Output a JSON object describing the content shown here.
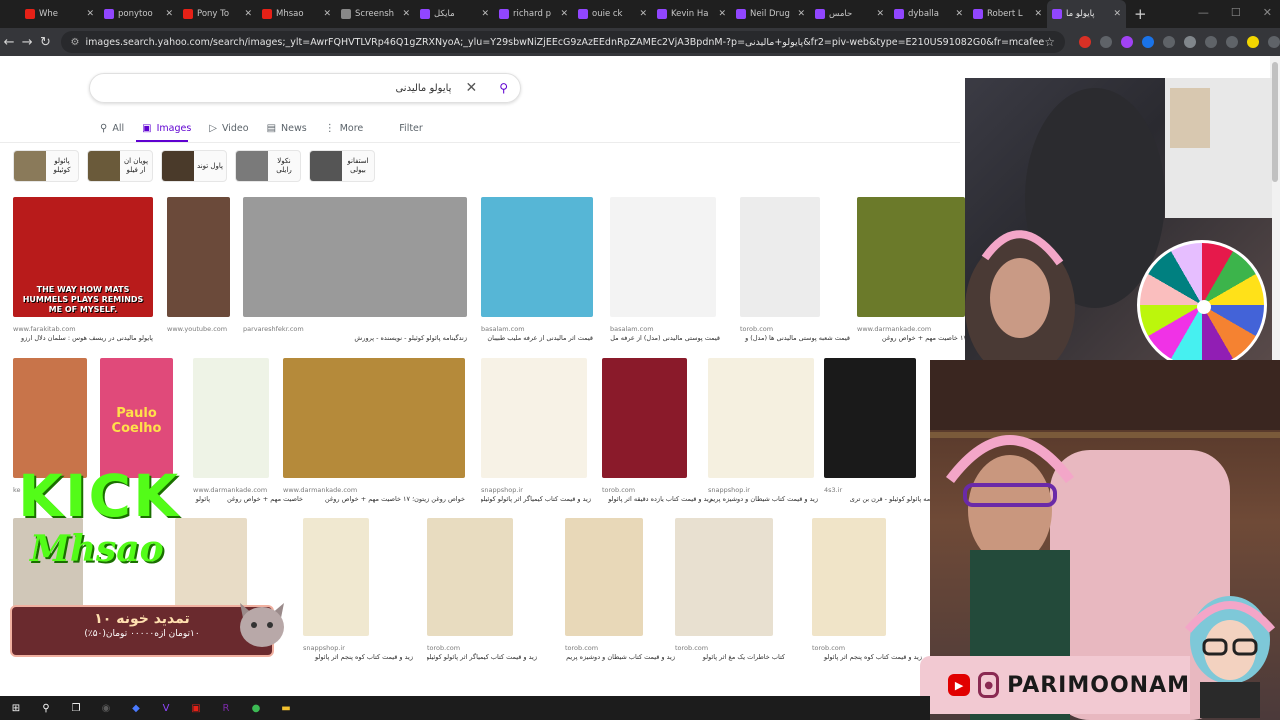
{
  "browser": {
    "tabs": [
      {
        "title": "Whe",
        "color": "#e62117"
      },
      {
        "title": "ponytoo",
        "color": "#9146ff"
      },
      {
        "title": "Pony To",
        "color": "#e62117"
      },
      {
        "title": "Mhsao",
        "color": "#e62117"
      },
      {
        "title": "Screensh",
        "color": "#888888"
      },
      {
        "title": "مایکل",
        "color": "#9146ff"
      },
      {
        "title": "richard p",
        "color": "#9146ff"
      },
      {
        "title": "ouie ck",
        "color": "#9146ff"
      },
      {
        "title": "Kevin Ha",
        "color": "#9146ff"
      },
      {
        "title": "Neil Drug",
        "color": "#9146ff"
      },
      {
        "title": "حامس",
        "color": "#9146ff"
      },
      {
        "title": "dyballa",
        "color": "#9146ff"
      },
      {
        "title": "Robert L",
        "color": "#9146ff"
      },
      {
        "title": "پایولو ما",
        "color": "#9146ff",
        "active": true
      }
    ],
    "new_tab": "+",
    "url": "images.search.yahoo.com/search/images;_ylt=AwrFQHVTLVRp46Q1gZRXNyoA;_ylu=Y29sbwNiZjEEcG9zAzEEdnRpZAMEc2VjA3BpdnM-?p=پایولو+مالیدنی&fr2=piv-web&type=E210US91082G0&fr=mcafee"
  },
  "search": {
    "query": "پایولو مالیدنی",
    "clear_icon": "✕",
    "search_icon": "⚲"
  },
  "nav": {
    "all": "All",
    "images": "Images",
    "video": "Video",
    "news": "News",
    "more": "More",
    "filter": "Filter"
  },
  "related": [
    {
      "label": "پائولو کوئیلو",
      "color": "#8a7a5a"
    },
    {
      "label": "پویان ان ار فیلو",
      "color": "#6a5a3a"
    },
    {
      "label": "پاول توند",
      "color": "#4a3a2a"
    },
    {
      "label": "نکولا رایلی",
      "color": "#7a7a7a"
    },
    {
      "label": "استفانو بیولی",
      "color": "#555555"
    }
  ],
  "results": {
    "row1": [
      {
        "source": "www.farakitab.com",
        "caption": "پایولو مالیدنی در ریسف هوس : سلمان دلال ارزو",
        "overlay": "THE WAY HOW MATS HUMMELS PLAYS REMINDS ME OF MYSELF.",
        "color": "#b81b1b"
      },
      {
        "source": "www.youtube.com",
        "caption": "",
        "color": "#6b4a3a"
      },
      {
        "source": "parvareshfekr.com",
        "caption": "زندگینامه پائولو کوئیلو - نویسنده - پرورش",
        "color": "#9a9a9a"
      },
      {
        "source": "basalam.com",
        "caption": "قیمت اثر مالیدنی از عرفه ملیب طبیبان",
        "color": "#56b6d6"
      },
      {
        "source": "basalam.com",
        "caption": "قیمت پوستی مالیدنی (مدل) از عرفه مل",
        "color": "#f3f3f3"
      },
      {
        "source": "torob.com",
        "caption": "قیمت شعبه پوستی مالیدنی ها (مدل) و",
        "color": "#ececec"
      },
      {
        "source": "www.darmankade.com",
        "caption": "۱۷ خاصیت مهم + خواص روغن",
        "color": "#6b7a2a"
      }
    ],
    "row2": [
      {
        "source": "ke",
        "caption": "",
        "color": "#c8744a"
      },
      {
        "source": "",
        "caption": "پائولو",
        "title": "Paulo Coelho",
        "color": "#e04a7a"
      },
      {
        "source": "www.darmankade.com",
        "caption": "خاصیت مهم + خواص روغن",
        "color": "#eef3e6"
      },
      {
        "source": "www.darmankade.com",
        "caption": "خواص روغن زیتون؛ ۱۷ خاصیت مهم + خواص روغن",
        "color": "#b58a3a"
      },
      {
        "source": "snappshop.ir",
        "caption": "زید و قیمت کتاب کیمیاگر اثر پائولو کوئیلو",
        "color": "#f7f2e6"
      },
      {
        "source": "torob.com",
        "caption": "زید و قیمت کتاب یازده دقیقه اثر پائولو",
        "color": "#8a1a2a"
      },
      {
        "source": "snappshop.ir",
        "caption": "زید و قیمت کتاب شیطان و دوشیزه پریم اثر",
        "color": "#f5f0e0"
      },
      {
        "source": "4s3.ir",
        "caption": "نامه پائولو کوئیلو - قرن بن تری",
        "color": "#1a1a1a"
      }
    ],
    "row3": [
      {
        "source": "",
        "caption": "",
        "color": "#d0c7b8"
      },
      {
        "source": "",
        "caption": "",
        "color": "#e8dcc6"
      },
      {
        "source": "snappshop.ir",
        "caption": "زید و قیمت کتاب کوه پنجم اثر پائولو",
        "color": "#f0e8d0"
      },
      {
        "source": "torob.com",
        "caption": "زید و قیمت کتاب کیمیاگر اثر پائولو کوئیلو",
        "color": "#e8dcc0"
      },
      {
        "source": "torob.com",
        "caption": "زید و قیمت کتاب شیطان و دوشیزه پریم اثر",
        "color": "#e8d8b8"
      },
      {
        "source": "torob.com",
        "caption": "کتاب خاطرات یک مغ اثر پائولو",
        "color": "#e8e0d0"
      },
      {
        "source": "torob.com",
        "caption": "زید و قیمت کتاب کوه پنجم اثر پائولو",
        "color": "#f0e4c8"
      }
    ]
  },
  "overlay": {
    "kick": "KICK",
    "channel": "Mhsao",
    "promo_line1": "تمدید خونه ۱۰",
    "promo_line2": "۱۰تومان ازه۰۰۰۰۰ تومان(۵۰٪)",
    "handle": "PARIMOONAM"
  },
  "taskbar": {
    "items": [
      {
        "icon": "windows-icon",
        "color": "#ffffff"
      },
      {
        "icon": "search-icon",
        "color": "#ffffff"
      },
      {
        "icon": "taskview-icon",
        "color": "#ffffff"
      },
      {
        "icon": "obs-icon",
        "color": "#5a5a5a"
      },
      {
        "icon": "app-icon",
        "color": "#4a7aff"
      },
      {
        "icon": "vs-icon",
        "color": "#9146ff"
      },
      {
        "icon": "chrome-ext-icon",
        "color": "#e62117"
      },
      {
        "icon": "r-icon",
        "color": "#7a2aa8"
      },
      {
        "icon": "chrome-icon",
        "color": "#3cba54"
      },
      {
        "icon": "folder-icon",
        "color": "#f2c12e"
      }
    ]
  }
}
